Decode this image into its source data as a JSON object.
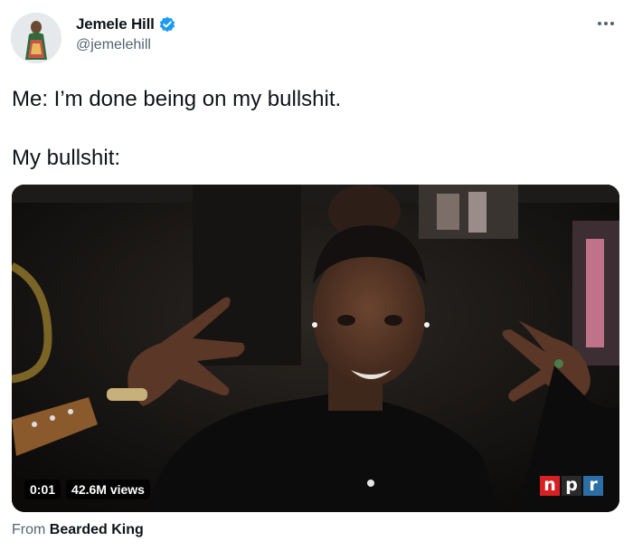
{
  "author": {
    "display_name": "Jemele Hill",
    "handle": "@jemelehill"
  },
  "tweet": {
    "line1": "Me: I’m done being on my bullshit.",
    "line2": "My bullshit:"
  },
  "video": {
    "time": "0:01",
    "views": "42.6M views",
    "watermark_letters": [
      "n",
      "p",
      "r"
    ],
    "watermark_colors": [
      "#d62021",
      "#2a2a2a",
      "#2e6ea6"
    ]
  },
  "attribution": {
    "prefix": "From",
    "source": "Bearded King"
  },
  "icons": {
    "verified": "verified-badge-icon",
    "more": "more-options-icon"
  },
  "colors": {
    "verified_blue": "#1d9bf0",
    "secondary_text": "#536471"
  }
}
